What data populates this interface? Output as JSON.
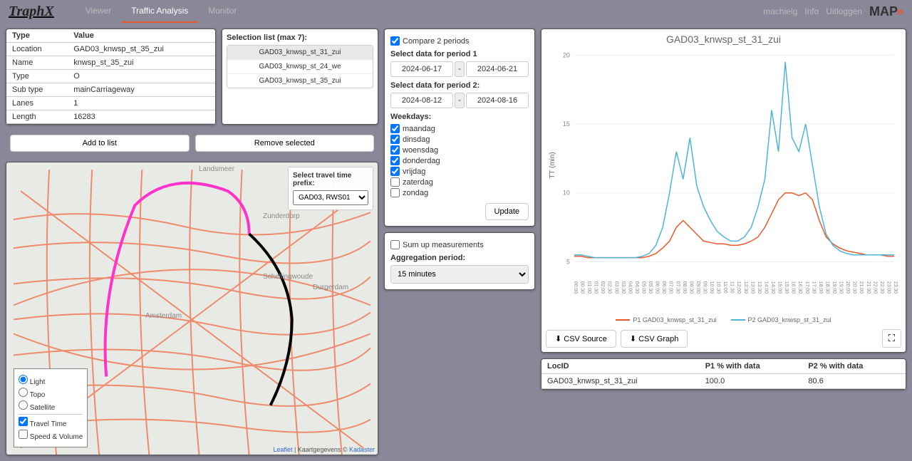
{
  "header": {
    "logo": "TraphX",
    "nav": [
      "Viewer",
      "Traffic Analysis",
      "Monitor"
    ],
    "active_nav": 1,
    "right": {
      "user": "machielg",
      "info": "Info",
      "logout": "Uitloggen",
      "brand": "MAP"
    }
  },
  "info": {
    "headers": [
      "Type",
      "Value"
    ],
    "rows": [
      [
        "Location",
        "GAD03_knwsp_st_35_zui"
      ],
      [
        "Name",
        "knwsp_st_35_zui"
      ],
      [
        "Type",
        "O"
      ],
      [
        "Sub type",
        "mainCarriageway"
      ],
      [
        "Lanes",
        "1"
      ],
      [
        "Length",
        "16283"
      ]
    ],
    "add_btn": "Add to list",
    "remove_btn": "Remove selected"
  },
  "selection": {
    "label": "Selection list (max 7):",
    "items": [
      "GAD03_knwsp_st_31_zui",
      "GAD03_knwsp_st_24_we",
      "GAD03_knwsp_st_35_zui"
    ],
    "selected": 0
  },
  "map": {
    "prefix_label": "Select travel time prefix:",
    "prefix_value": "GAD03, RWS01",
    "layers": {
      "base": [
        "Light",
        "Topo",
        "Satellite"
      ],
      "base_selected": 0,
      "overlays": [
        {
          "label": "Travel Time",
          "checked": true
        },
        {
          "label": "Speed & Volume",
          "checked": false
        }
      ]
    },
    "attrib": {
      "leaflet": "Leaflet",
      "sep": " | Kaartgegevens © ",
      "kadaster": "Kadaster"
    },
    "labels": [
      "Landsmeer",
      "Zunderdorp",
      "Schellingwoude",
      "Durgerdam",
      "Amsterdam"
    ]
  },
  "compare": {
    "compare_label": "Compare 2 periods",
    "compare_checked": true,
    "p1_label": "Select data for period 1",
    "p1_from": "2024-06-17",
    "p1_to": "2024-06-21",
    "p2_label": "Select data for period 2:",
    "p2_from": "2024-08-12",
    "p2_to": "2024-08-16",
    "weekdays_label": "Weekdays:",
    "weekdays": [
      {
        "label": "maandag",
        "checked": true
      },
      {
        "label": "dinsdag",
        "checked": true
      },
      {
        "label": "woensdag",
        "checked": true
      },
      {
        "label": "donderdag",
        "checked": true
      },
      {
        "label": "vrijdag",
        "checked": true
      },
      {
        "label": "zaterdag",
        "checked": false
      },
      {
        "label": "zondag",
        "checked": false
      }
    ],
    "update_btn": "Update"
  },
  "agg": {
    "sum_label": "Sum up measurements",
    "sum_checked": false,
    "period_label": "Aggregation period:",
    "period_value": "15 minutes"
  },
  "chart_data": {
    "type": "line",
    "title": "GAD03_knwsp_st_31_zui",
    "ylabel": "TT (min)",
    "xlabel": "",
    "ylim": [
      4,
      20
    ],
    "yticks": [
      5,
      10,
      15,
      20
    ],
    "categories": [
      "00:00",
      "00:30",
      "01:00",
      "01:30",
      "02:00",
      "02:30",
      "03:00",
      "03:30",
      "04:00",
      "04:30",
      "05:00",
      "05:30",
      "06:00",
      "06:30",
      "07:00",
      "07:30",
      "08:00",
      "08:30",
      "09:00",
      "09:30",
      "10:00",
      "10:30",
      "11:00",
      "11:30",
      "12:00",
      "12:30",
      "13:00",
      "13:30",
      "14:00",
      "14:30",
      "15:00",
      "15:30",
      "16:00",
      "16:30",
      "17:00",
      "17:30",
      "18:00",
      "18:30",
      "19:00",
      "19:30",
      "20:00",
      "20:30",
      "21:00",
      "21:30",
      "22:00",
      "22:30",
      "23:00",
      "23:30"
    ],
    "series": [
      {
        "name": "P1 GAD03_knwsp_st_31_zui",
        "color": "#e85a2a",
        "values": [
          5.4,
          5.4,
          5.3,
          5.3,
          5.3,
          5.3,
          5.3,
          5.3,
          5.3,
          5.3,
          5.3,
          5.4,
          5.6,
          6.0,
          6.5,
          7.5,
          8.0,
          7.5,
          7.0,
          6.5,
          6.4,
          6.3,
          6.3,
          6.2,
          6.2,
          6.3,
          6.5,
          6.8,
          7.5,
          8.5,
          9.5,
          10.0,
          10.0,
          9.8,
          10.0,
          9.5,
          8.0,
          6.8,
          6.3,
          6.0,
          5.8,
          5.7,
          5.6,
          5.5,
          5.5,
          5.5,
          5.4,
          5.4
        ]
      },
      {
        "name": "P2 GAD03_knwsp_st_31_zui",
        "color": "#4fb4d8",
        "values": [
          5.5,
          5.5,
          5.4,
          5.3,
          5.3,
          5.3,
          5.3,
          5.3,
          5.3,
          5.3,
          5.4,
          5.6,
          6.2,
          7.5,
          10.0,
          13.0,
          11.0,
          14.0,
          10.5,
          9.0,
          8.0,
          7.2,
          6.8,
          6.5,
          6.5,
          6.8,
          7.5,
          9.0,
          11.0,
          16.0,
          13.0,
          19.5,
          14.0,
          13.0,
          15.0,
          12.0,
          9.0,
          7.0,
          6.2,
          5.8,
          5.6,
          5.5,
          5.5,
          5.5,
          5.5,
          5.5,
          5.5,
          5.5
        ]
      }
    ],
    "csv_source_btn": "CSV Source",
    "csv_graph_btn": "CSV Graph"
  },
  "data_table": {
    "headers": [
      "LocID",
      "P1 % with data",
      "P2 % with data"
    ],
    "rows": [
      [
        "GAD03_knwsp_st_31_zui",
        "100.0",
        "80.6"
      ]
    ]
  }
}
